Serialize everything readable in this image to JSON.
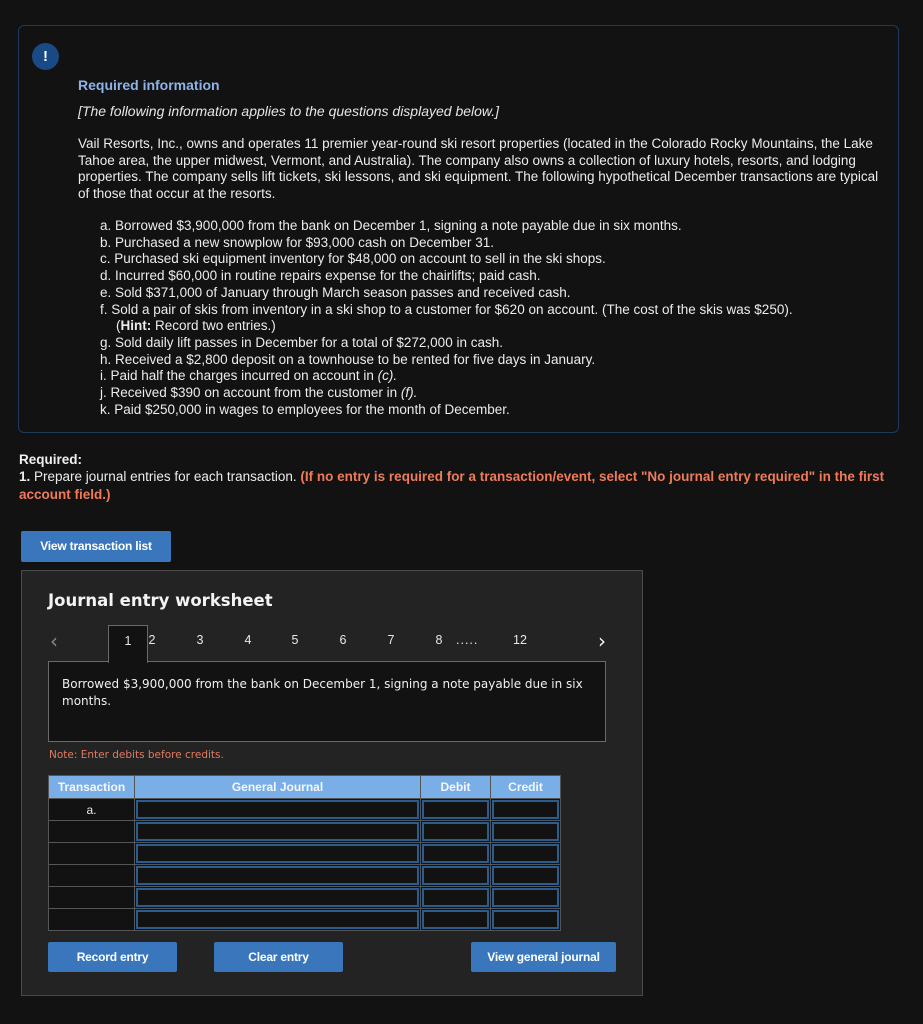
{
  "info": {
    "badge": "!",
    "title": "Required information",
    "subtitle": "[The following information applies to the questions displayed below.]",
    "paragraph": "Vail Resorts, Inc., owns and operates 11 premier year-round ski resort properties (located in the Colorado Rocky Mountains, the Lake Tahoe area, the upper midwest, Vermont, and Australia). The company also owns a collection of luxury hotels, resorts, and lodging properties. The company sells lift tickets, ski lessons, and ski equipment. The following hypothetical December transactions are typical of those that occur at the resorts.",
    "transactions": [
      "a. Borrowed $3,900,000 from the bank on December 1, signing a note payable due in six months.",
      "b. Purchased a new snowplow for $93,000 cash on December 31.",
      "c. Purchased ski equipment inventory for $48,000 on account to sell in the ski shops.",
      "d. Incurred $60,000 in routine repairs expense for the chairlifts; paid cash.",
      "e. Sold $371,000 of January through March season passes and received cash.",
      "f. Sold a pair of skis from inventory in a ski shop to a customer for $620 on account. (The cost of the skis was $250).",
      "g. Sold daily lift passes in December for a total of $272,000 in cash.",
      "h. Received a $2,800 deposit on a townhouse to be rented for five days in January.",
      "i. Paid half the charges incurred on account in ",
      "j. Received $390 on account from the customer in ",
      "k. Paid $250,000 in wages to employees for the month of December."
    ],
    "hint_bold": "Hint:",
    "hint_rest": " Record two entries.)",
    "hint_open": "(",
    "ref_c": "(c).",
    "ref_f": "(f)."
  },
  "required": {
    "label": "Required:",
    "number": "1.",
    "text": " Prepare journal entries for each transaction. ",
    "hint": "(If no entry is required for a transaction/event, select \"No journal entry required\" in the first account field.)"
  },
  "buttons": {
    "view_transaction_list": "View transaction list",
    "record_entry": "Record entry",
    "clear_entry": "Clear entry",
    "view_general_journal": "View general journal"
  },
  "worksheet": {
    "title": "Journal entry worksheet",
    "prev_arrow": "‹",
    "next_arrow": "›",
    "tabs": [
      "1",
      "2",
      "3",
      "4",
      "5",
      "6",
      "7",
      "8",
      "12"
    ],
    "active_tab": "1",
    "ellipsis": ".....",
    "description": "Borrowed $3,900,000 from the bank on December 1, signing a note payable due in six months.",
    "note": "Note: Enter debits before credits.",
    "columns": [
      "Transaction",
      "General Journal",
      "Debit",
      "Credit"
    ],
    "rows": [
      {
        "transaction": "a.",
        "account": "",
        "debit": "",
        "credit": ""
      },
      {
        "transaction": "",
        "account": "",
        "debit": "",
        "credit": ""
      },
      {
        "transaction": "",
        "account": "",
        "debit": "",
        "credit": ""
      },
      {
        "transaction": "",
        "account": "",
        "debit": "",
        "credit": ""
      },
      {
        "transaction": "",
        "account": "",
        "debit": "",
        "credit": ""
      },
      {
        "transaction": "",
        "account": "",
        "debit": "",
        "credit": ""
      }
    ]
  },
  "colors": {
    "accent_blue": "#3a76bb",
    "header_blue": "#7aaee6",
    "hint_red": "#f07a5a",
    "title_blue": "#8fb3e8"
  }
}
